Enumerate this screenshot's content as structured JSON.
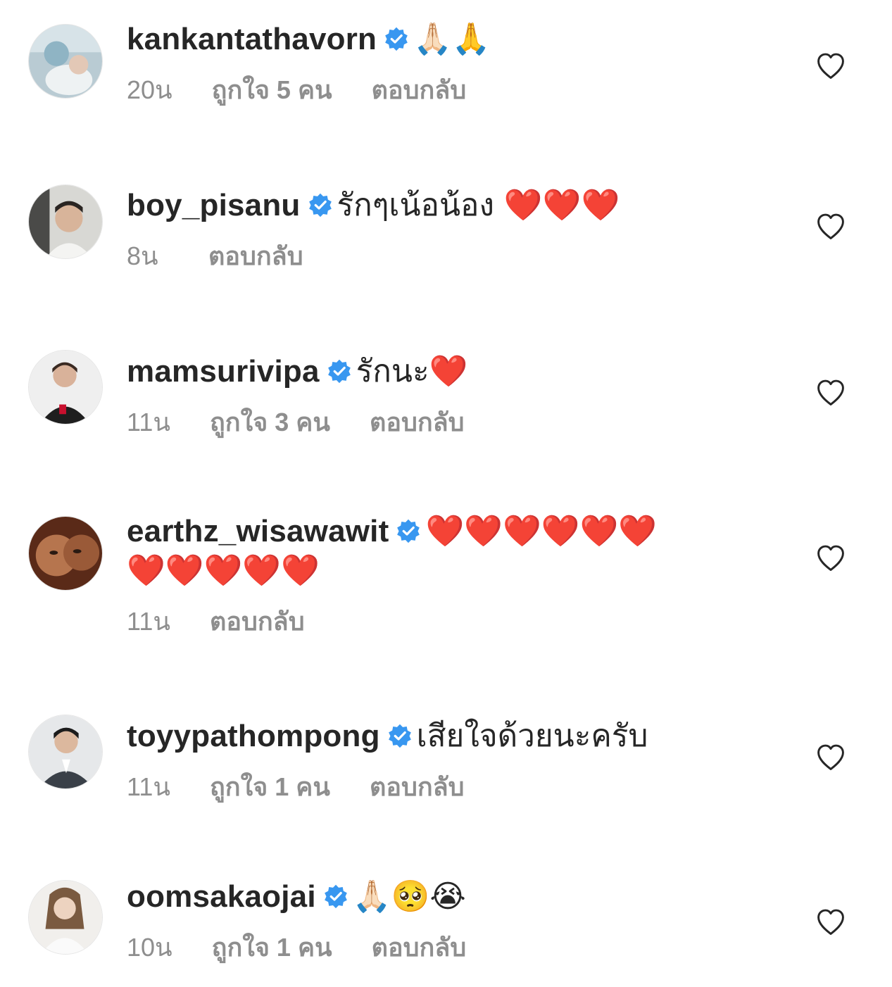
{
  "accent_badge_color": "#3897f0",
  "meta_color": "#8e8e8e",
  "comments": [
    {
      "username": "kankantathavorn",
      "text": "🙏🏻🙏",
      "time": "20น",
      "likes": "ถูกใจ 5 คน",
      "reply": "ตอบกลับ",
      "avatar_icon": "avatar-hospital-newborn"
    },
    {
      "username": "boy_pisanu",
      "text": "รักๆเน้อน้อง ❤️❤️❤️",
      "time": "8น",
      "likes": "",
      "reply": "ตอบกลับ",
      "avatar_icon": "avatar-selfie-man"
    },
    {
      "username": "mamsurivipa",
      "text": "รักนะ❤️",
      "time": "11น",
      "likes": "ถูกใจ 3 คน",
      "reply": "ตอบกลับ",
      "avatar_icon": "avatar-woman-uniform"
    },
    {
      "username": "earthz_wisawawit",
      "text": "❤️❤️❤️❤️❤️❤️",
      "text2": "❤️❤️❤️❤️❤️",
      "time": "11น",
      "likes": "",
      "reply": "ตอบกลับ",
      "avatar_icon": "avatar-man-closeup"
    },
    {
      "username": "toyypathompong",
      "text": "เสียใจด้วยนะครับ",
      "time": "11น",
      "likes": "ถูกใจ 1 คน",
      "reply": "ตอบกลับ",
      "avatar_icon": "avatar-man-suit"
    },
    {
      "username": "oomsakaojai",
      "text": "🙏🏻🥺😭",
      "time": "10น",
      "likes": "ถูกใจ 1 คน",
      "reply": "ตอบกลับ",
      "avatar_icon": "avatar-woman-white"
    }
  ],
  "icons": {
    "verified": "verified-badge-icon",
    "like": "heart-outline-icon"
  }
}
